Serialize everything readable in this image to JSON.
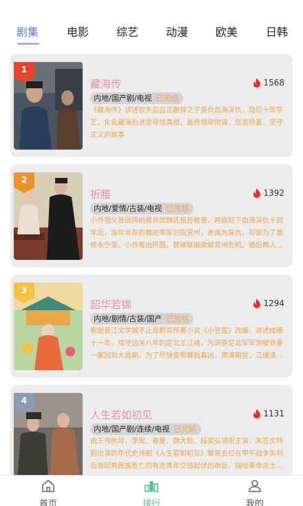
{
  "tabs": [
    "剧集",
    "电影",
    "综艺",
    "动漫",
    "欧美",
    "日韩"
  ],
  "active_tab": "剧集",
  "items": [
    {
      "rank": "1",
      "title": "藏海传",
      "heat": "1568",
      "genre": "内地/国产剧/电视",
      "status": "已完结",
      "desc": "《藏海传》讲述钦天监监正蒯铎之子身负血海深仇，隐忍十年学艺，化名藏海后进京寻找真相，最终揭穿阴谋、惩恶扬善、坚守正义的故事"
    },
    {
      "rank": "2",
      "title": "折腰",
      "heat": "1392",
      "genre": "内地/爱情/古装/电视",
      "status": "已完结",
      "desc": "小乔祖父曾因阵前撤兵致魏氏祖孙被害，两族结下血海深仇十四年后，当年幸存的魏劭率军剑指兖州，表面为复仇，却是为了重修永宁渠。小乔看出所图，替嫁联姻欲解兖州危机。婚后两人..."
    },
    {
      "rank": "3",
      "title": "韶华若锦",
      "heat": "1294",
      "genre": "内地/剧情/古装/国产",
      "status": "已完结",
      "desc": "根据晋江文学城不止是颗菜所著小说《小豆蔻》改编，讲述成康十一年，戍守边关八年的定北王江绪，为调查定北军军饷被贪墨一案回到大昌朝。为了尽快查明幕后真凶，肃清朝堂，江绪请..."
    },
    {
      "rank": "4",
      "title": "人生若如初见",
      "heat": "1131",
      "genre": "内地/国产剧/连续/电视",
      "status": "已完结",
      "desc": "由王伟执导，李现、春夏、魏大勋、段奕弘领衔主演，朱亚文特别出演的年代史诗剧《人生若如初见》聚焦五位在甲午战争失利后奋起救民族危亡的有志青年交错起伏的命运，描绘革命志士..."
    }
  ],
  "bottom_nav": [
    {
      "label": "首页",
      "icon": "home-icon"
    },
    {
      "label": "排行",
      "icon": "ranking-icon"
    },
    {
      "label": "我的",
      "icon": "user-icon"
    }
  ],
  "active_nav": "排行",
  "colors": {
    "accent_tab": "#5b7bd6",
    "title_pink": "#ec8cae",
    "desc_orange": "#f3a24a",
    "nav_active": "#4fc08d",
    "heat_red": "#e8322c",
    "rank1": "#e8432c",
    "rank2": "#f0922c",
    "rank3": "#f5c046",
    "rank4": "#8c9bb0"
  }
}
